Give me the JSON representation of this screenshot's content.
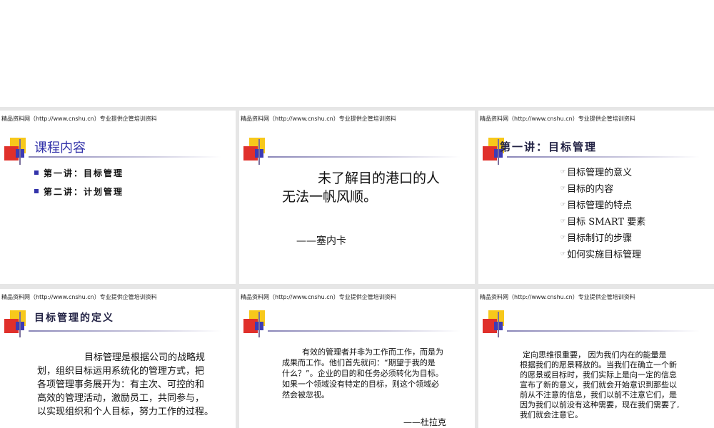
{
  "header": "精品资料网（http://www.cnshu.cn）专业提供企管培训资料",
  "slides": {
    "s1": {
      "title": "课程内容",
      "items": [
        "第一讲：目标管理",
        "第二讲：计划管理"
      ]
    },
    "s2": {
      "quote_line1": "未了解目的港口的人",
      "quote_line2": "无法一帆风顺。",
      "author": "——塞内卡"
    },
    "s3": {
      "title": "第一讲：目标管理",
      "items": [
        "目标管理的意义",
        "目标的内容",
        "目标管理的特点",
        "目标 SMART 要素",
        "目标制订的步骤",
        "如何实施目标管理"
      ]
    },
    "s4": {
      "title": "目标管理的定义",
      "lines": [
        "目标管理是根据公司的战略规",
        "划，组织目标运用系统化的管理方式，把",
        "各项管理事务展开为：有主次、可控的和",
        "高效的管理活动，激励员工，共同参与，",
        "以实现组织和个人目标，努力工作的过程。"
      ]
    },
    "s5": {
      "lines": [
        "有效的管理者并非为工作而工作，而是为",
        "成果而工作。他们首先就问：“期望于我的是",
        "什么？”。企业的目的和任务必须转化为目标。",
        "如果一个领域没有特定的目标，则这个领域必",
        "然会被忽视。"
      ],
      "author": "——杜拉克"
    },
    "s6": {
      "lines": [
        "定向思维很重要，   因为我们内在的能量是",
        "根据我们的愿景释放的。当我们在确立一个新",
        "的愿景或目标时，我们实际上是向一定的信息",
        "宣布了新的意义，我们就会开始意识到那些以",
        "前从不注意的信息，我们以前不注意它们，是",
        "因为我们以前没有这种需要，现在我们需要了,",
        "我们就会注意它。"
      ]
    }
  }
}
